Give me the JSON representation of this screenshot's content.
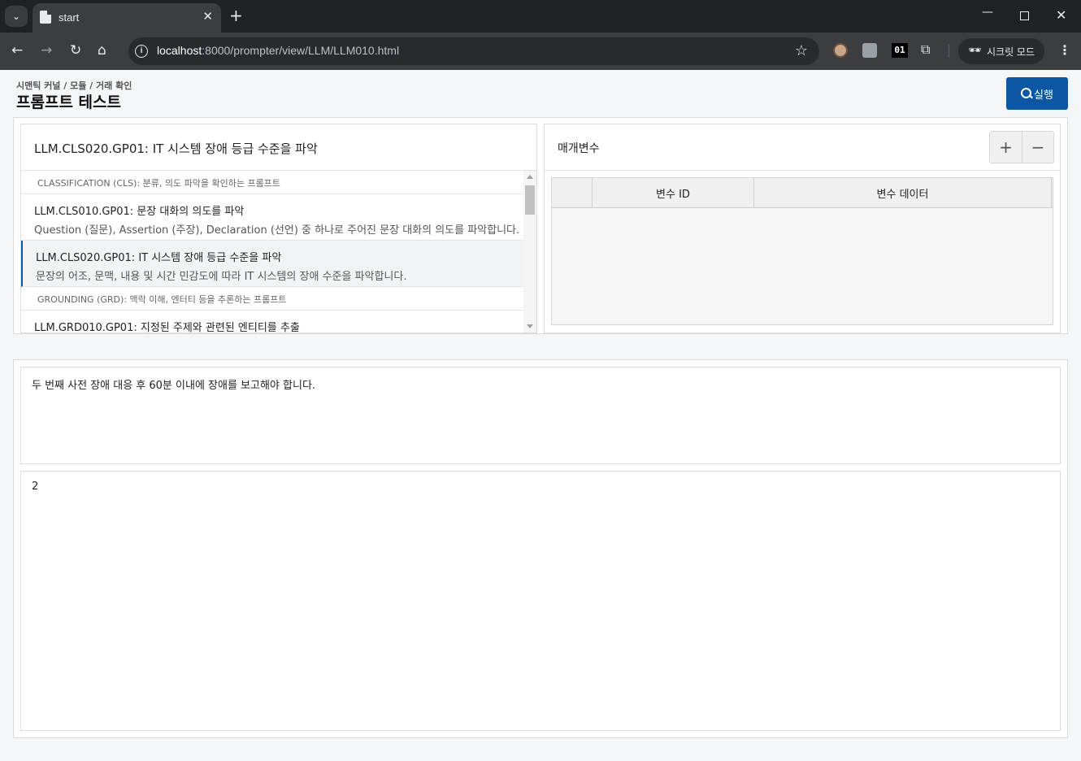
{
  "browser": {
    "tab_title": "start",
    "url_host": "localhost",
    "url_path": ":8000/prompter/view/LLM/LLM010.html",
    "incognito_label": "시크릿 모드",
    "ext3_label": "01"
  },
  "page": {
    "breadcrumb": "시맨틱 커널 / 모듈 / 거래 확인",
    "title": "프롬프트 테스트",
    "run_label": "실행"
  },
  "prompt_panel": {
    "title": "LLM.CLS020.GP01: IT 시스템 장애 등급 수준을 파악",
    "groups": [
      {
        "header": "CLASSIFICATION (CLS): 분류, 의도 파악을 확인하는 프롬프트",
        "items": [
          {
            "title": "LLM.CLS010.GP01: 문장 대화의 의도를 파악",
            "desc": "Question (질문), Assertion (주장), Declaration (선언) 중 하나로 주어진 문장 대화의 의도를 파악합니다."
          },
          {
            "title": "LLM.CLS020.GP01: IT 시스템 장애 등급 수준을 파악",
            "desc": "문장의 어조, 문맥, 내용 및 시간 민감도에 따라 IT 시스템의 장애 수준을 파악합니다.",
            "selected": true
          }
        ]
      },
      {
        "header": "GROUNDING (GRD): 맥락 이해, 엔터티 등을 추론하는 프롬프트",
        "items": [
          {
            "title": "LLM.GRD010.GP01: 지정된 주제와 관련된 엔티티를 추출",
            "desc": ""
          }
        ]
      }
    ]
  },
  "params_panel": {
    "title": "매개변수",
    "add_label": "+",
    "remove_label": "−",
    "columns": [
      "",
      "변수 ID",
      "변수 데이터"
    ],
    "rows": []
  },
  "input_text": "두 번째 사전 장애 대응 후 60분 이내에 장애를 보고해야 합니다.",
  "output_text": "2"
}
